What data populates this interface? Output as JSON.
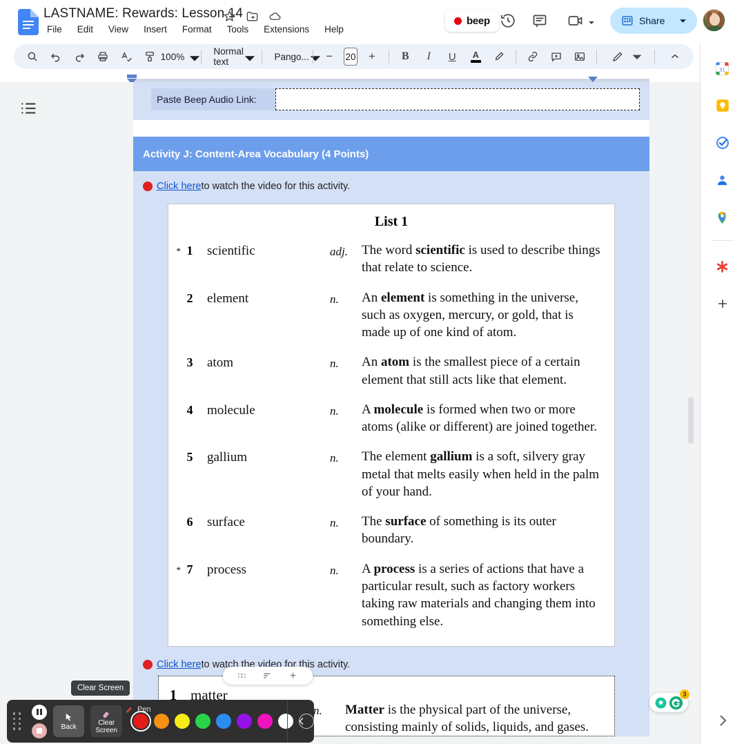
{
  "window": {
    "app": "Google Docs",
    "doc_title": "LASTNAME: Rewards: Lesson 14"
  },
  "menubar": {
    "items": [
      "File",
      "Edit",
      "View",
      "Insert",
      "Format",
      "Tools",
      "Extensions",
      "Help"
    ]
  },
  "title_icons": [
    {
      "name": "star-icon",
      "label": "Star"
    },
    {
      "name": "move-to-folder-icon",
      "label": "Move"
    },
    {
      "name": "cloud-saved-icon",
      "label": "Saved to Drive"
    }
  ],
  "header_actions": {
    "beep_label": "beep",
    "history_label": "Version history",
    "comment_label": "Comments",
    "meet_label": "Join a call",
    "share_label": "Share",
    "avatar_label": "Account"
  },
  "toolbar": {
    "search_label": "Search",
    "undo_label": "Undo",
    "redo_label": "Redo",
    "print_label": "Print",
    "spellcheck_label": "Spelling and grammar check",
    "paint_format_label": "Paint format",
    "zoom_value": "100%",
    "style_value": "Normal text",
    "font_value": "Pango...",
    "font_size_value": "20",
    "decrease_font_label": "−",
    "increase_font_label": "+",
    "bold_label": "B",
    "italic_label": "I",
    "underline_label": "U",
    "text_color_label": "A",
    "highlight_label": "Highlight color",
    "link_label": "Insert link",
    "comment_add_label": "Add comment",
    "image_label": "Insert image",
    "editing_mode_label": "Editing mode",
    "collapse_label": "Hide the menus"
  },
  "document": {
    "paste_row": {
      "label": "Paste Beep Audio Link:",
      "input_value": "",
      "placeholder": ""
    },
    "activity": {
      "heading": "Activity J: Content-Area Vocabulary (4 Points)",
      "video_line_prefix": "",
      "video_link_text": "Click here ",
      "video_line_suffix": "to watch the video for this activity."
    },
    "vocab_list": {
      "title": "List 1",
      "entries": [
        {
          "star": "*",
          "num": "1",
          "word": "scientific",
          "pos": "adj.",
          "def_lead": "The word ",
          "def_bold": "scientific",
          "def_rest": " is used to describe things that relate to science."
        },
        {
          "star": "",
          "num": "2",
          "word": "element",
          "pos": "n.",
          "def_lead": "An ",
          "def_bold": "element",
          "def_rest": " is something in the universe, such as oxygen, mercury, or gold, that is made up of one kind of atom."
        },
        {
          "star": "",
          "num": "3",
          "word": "atom",
          "pos": "n.",
          "def_lead": "An ",
          "def_bold": "atom",
          "def_rest": " is the smallest piece of a certain element that still acts like that element."
        },
        {
          "star": "",
          "num": "4",
          "word": "molecule",
          "pos": "n.",
          "def_lead": "A ",
          "def_bold": "molecule",
          "def_rest": " is formed when two or more atoms (alike or different) are joined together."
        },
        {
          "star": "",
          "num": "5",
          "word": "gallium",
          "pos": "n.",
          "def_lead": "The element ",
          "def_bold": "gallium",
          "def_rest": " is a soft, silvery gray metal that melts easily when held in the palm of your hand."
        },
        {
          "star": "",
          "num": "6",
          "word": "surface",
          "pos": "n.",
          "def_lead": "The ",
          "def_bold": "surface",
          "def_rest": " of something is its outer boundary."
        },
        {
          "star": "*",
          "num": "7",
          "word": "process",
          "pos": "n.",
          "def_lead": "A ",
          "def_bold": "process",
          "def_rest": " is a series of actions that have a particular result, such as factory workers taking raw materials and changing them into something else."
        }
      ]
    },
    "second_video_line": {
      "link_text": "Click here",
      "suffix": " to watch the video for this activity."
    },
    "vocab_list_2": {
      "entries": [
        {
          "num": "1",
          "word": "matter",
          "pos": "n.",
          "def_bold": "Matter",
          "def_rest": " is the physical part of the universe, consisting mainly of solids, liquids, and gases."
        }
      ]
    },
    "table_controls": {
      "drag_label": "Drag to move table",
      "options_label": "Table options",
      "add_label": "Insert"
    }
  },
  "sidebar": {
    "items": [
      {
        "name": "google-calendar-icon",
        "label": "Calendar",
        "badge": "31"
      },
      {
        "name": "google-keep-icon",
        "label": "Keep"
      },
      {
        "name": "google-tasks-icon",
        "label": "Tasks"
      },
      {
        "name": "google-contacts-icon",
        "label": "Contacts"
      },
      {
        "name": "google-maps-icon",
        "label": "Maps"
      },
      {
        "name": "addon-asterisk-icon",
        "label": "Add-on"
      },
      {
        "name": "add-addon-icon",
        "label": "Get add-ons"
      }
    ],
    "expand_label": "Show side panel"
  },
  "grammarly": {
    "label": "Grammarly",
    "badge": "3"
  },
  "annotation_toolbar": {
    "tooltip": "Clear Screen",
    "grip_label": "Drag toolbar",
    "pause_label": "Pause recording",
    "stop_label": "Stop recording",
    "back_label": "Back",
    "clear_label_line1": "Clear",
    "clear_label_line2": "Screen",
    "tool_label": "Pen",
    "collapse_label": "Collapse toolbar",
    "colors": [
      {
        "name": "red",
        "hex": "#e21b1b",
        "selected": true
      },
      {
        "name": "orange",
        "hex": "#f49013",
        "selected": false
      },
      {
        "name": "yellow",
        "hex": "#f6ea18",
        "selected": false
      },
      {
        "name": "green",
        "hex": "#2ad44a",
        "selected": false
      },
      {
        "name": "blue",
        "hex": "#2b8cf0",
        "selected": false
      },
      {
        "name": "purple",
        "hex": "#9612e8",
        "selected": false
      },
      {
        "name": "magenta",
        "hex": "#f213c0",
        "selected": false
      },
      {
        "name": "white",
        "hex": "#ffffff",
        "selected": false
      },
      {
        "name": "transparent",
        "hex": "transparent",
        "selected": false
      }
    ]
  },
  "colors": {
    "accent_blue": "#6d9eeb",
    "table_bg": "#d4e0f5",
    "link_blue": "#1155cc",
    "toolbar_bg": "#edf2fa",
    "share_bg": "#c2e7ff",
    "canvas_bg": "#f1f3f4"
  }
}
